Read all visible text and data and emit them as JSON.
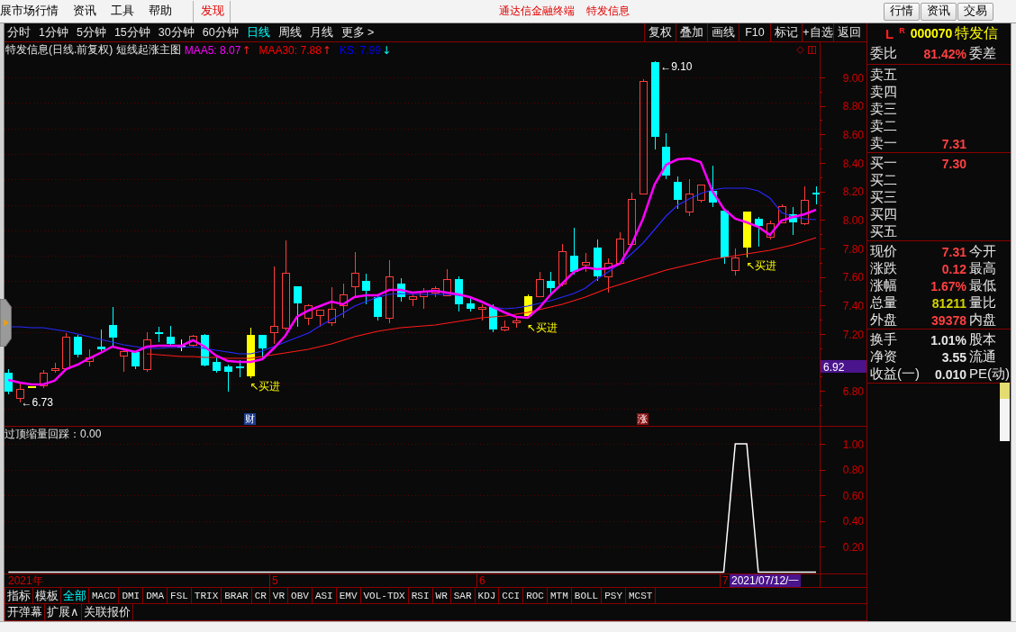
{
  "menu_bar": {
    "items": [
      {
        "label": "展市场行情",
        "highlighted": false
      },
      {
        "label": "资讯",
        "highlighted": false
      },
      {
        "label": "工具",
        "highlighted": false
      },
      {
        "label": "帮助",
        "highlighted": false
      },
      {
        "label": "发现",
        "highlighted": true
      }
    ],
    "title": [
      "通达信金融终端",
      "特发信息"
    ],
    "buttons": [
      "行情",
      "资讯",
      "交易"
    ]
  },
  "period_bar": {
    "periods": [
      {
        "label": "分时",
        "selected": false
      },
      {
        "label": "1分钟",
        "selected": false
      },
      {
        "label": "5分钟",
        "selected": false
      },
      {
        "label": "15分钟",
        "selected": false
      },
      {
        "label": "30分钟",
        "selected": false
      },
      {
        "label": "60分钟",
        "selected": false
      },
      {
        "label": "日线",
        "selected": true
      },
      {
        "label": "周线",
        "selected": false
      },
      {
        "label": "月线",
        "selected": false
      },
      {
        "label": "更多 >",
        "selected": false
      }
    ],
    "tools": [
      "复权",
      "叠加",
      "画线",
      "F10",
      "标记",
      "+自选",
      "返回"
    ]
  },
  "main_chart": {
    "title": "特发信息(日线.前复权) 短线起涨主图",
    "legend": [
      {
        "label": "MAA5: 8.07",
        "color": "#ff00ff",
        "arrow": "↑",
        "rising": true
      },
      {
        "label": "MAA30: 7.88",
        "color": "#ff0000",
        "arrow": "↑",
        "rising": true
      },
      {
        "label": "KS: 7.99",
        "color": "#0000ff",
        "arrow": "↓",
        "rising": false
      }
    ],
    "price_axis": [
      "9.00",
      "8.80",
      "8.60",
      "8.40",
      "8.20",
      "8.00",
      "7.80",
      "7.60",
      "7.40",
      "7.20",
      "6.80"
    ],
    "cursor_price": "6.92",
    "annotations": [
      {
        "kind": "high",
        "text": "←9.10"
      },
      {
        "kind": "low",
        "text": "←6.73"
      },
      {
        "kind": "buy",
        "text": "↖买进"
      },
      {
        "kind": "buy",
        "text": "↖买进"
      },
      {
        "kind": "buy",
        "text": "↖买进"
      }
    ],
    "markers": [
      {
        "kind": "finance",
        "label": "财"
      },
      {
        "kind": "limit_up",
        "label": "涨"
      }
    ]
  },
  "indicator": {
    "reading": "：0.00",
    "chart_data": {
      "type": "line",
      "series": [
        {
          "name": "过顶缩量回踩",
          "color": "#ffffff",
          "values": [
            0,
            0,
            0,
            0,
            0,
            0,
            0,
            0,
            0,
            0,
            0,
            0,
            0,
            0,
            0,
            0,
            0,
            0,
            0,
            0,
            0,
            0,
            0,
            0,
            0,
            0,
            0,
            0,
            0,
            0,
            0,
            0,
            0,
            0,
            0,
            0,
            0,
            0,
            0,
            0,
            0,
            0,
            0,
            0,
            0,
            0,
            0,
            0,
            0,
            0,
            0,
            0,
            0,
            0,
            0,
            0,
            0,
            0,
            0,
            0,
            0,
            0,
            0,
            1,
            1,
            0,
            0,
            0,
            0,
            0,
            0
          ]
        }
      ],
      "ylim": [
        0,
        1.13
      ],
      "yticks": [
        {
          "value": 1,
          "label": "1.00"
        },
        {
          "value": 0.8,
          "label": "0.80"
        },
        {
          "value": 0.6,
          "label": "0.60"
        },
        {
          "value": 0.4,
          "label": "0.40"
        },
        {
          "value": 0.2,
          "label": "0.20"
        }
      ],
      "grid": true
    }
  },
  "time_axis": {
    "labels": [
      {
        "kind": "year",
        "text": "2021年"
      },
      {
        "kind": "month",
        "text": "5"
      },
      {
        "kind": "month",
        "text": "6"
      },
      {
        "kind": "month",
        "text": "7"
      }
    ],
    "cursor_date": "2021/07/12/一"
  },
  "indicator_tabs": [
    {
      "label": "指标",
      "kind": "category",
      "selected": false
    },
    {
      "label": "模板",
      "kind": "category",
      "selected": false
    },
    {
      "label": "全部",
      "kind": "category",
      "selected": true
    },
    {
      "label": "MACD",
      "kind": "indicator",
      "selected": false
    },
    {
      "label": "DMI",
      "kind": "indicator",
      "selected": false
    },
    {
      "label": "DMA",
      "kind": "indicator",
      "selected": false
    },
    {
      "label": "FSL",
      "kind": "indicator",
      "selected": false
    },
    {
      "label": "TRIX",
      "kind": "indicator",
      "selected": false
    },
    {
      "label": "BRAR",
      "kind": "indicator",
      "selected": false
    },
    {
      "label": "CR",
      "kind": "indicator",
      "selected": false
    },
    {
      "label": "VR",
      "kind": "indicator",
      "selected": false
    },
    {
      "label": "OBV",
      "kind": "indicator",
      "selected": false
    },
    {
      "label": "ASI",
      "kind": "indicator",
      "selected": false
    },
    {
      "label": "EMV",
      "kind": "indicator",
      "selected": false
    },
    {
      "label": "VOL-TDX",
      "kind": "indicator",
      "selected": false
    },
    {
      "label": "RSI",
      "kind": "indicator",
      "selected": false
    },
    {
      "label": "WR",
      "kind": "indicator",
      "selected": false
    },
    {
      "label": "SAR",
      "kind": "indicator",
      "selected": false
    },
    {
      "label": "KDJ",
      "kind": "indicator",
      "selected": false
    },
    {
      "label": "CCI",
      "kind": "indicator",
      "selected": false
    },
    {
      "label": "ROC",
      "kind": "indicator",
      "selected": false
    },
    {
      "label": "MTM",
      "kind": "indicator",
      "selected": false
    },
    {
      "label": "BOLL",
      "kind": "indicator",
      "selected": false
    },
    {
      "label": "PSY",
      "kind": "indicator",
      "selected": false
    },
    {
      "label": "MCST",
      "kind": "indicator",
      "selected": false
    }
  ],
  "bottom_buttons": [
    "开弹幕",
    "扩展∧",
    "关联报价"
  ],
  "quote": {
    "market": "L",
    "flag": "R",
    "code": "000070",
    "name": "特发信",
    "ratio": {
      "label": "委比",
      "value": "81.42%",
      "label2": "委差"
    },
    "asks": [
      {
        "label": "卖五"
      },
      {
        "label": "卖四"
      },
      {
        "label": "卖三"
      },
      {
        "label": "卖二"
      },
      {
        "label": "卖一",
        "price": "7.31"
      }
    ],
    "bids": [
      {
        "label": "买一",
        "price": "7.30"
      },
      {
        "label": "买二"
      },
      {
        "label": "买三"
      },
      {
        "label": "买四"
      },
      {
        "label": "买五"
      }
    ],
    "stats": [
      {
        "label": "现价",
        "value": "7.31",
        "color": "#ff4040",
        "label2": "今开"
      },
      {
        "label": "涨跌",
        "value": "0.12",
        "color": "#ff4040",
        "label2": "最高"
      },
      {
        "label": "涨幅",
        "value": "1.67%",
        "color": "#ff4040",
        "label2": "最低"
      },
      {
        "label": "总量",
        "value": "81211",
        "color": "#d2d200",
        "label2": "量比"
      },
      {
        "label": "外盘",
        "value": "39378",
        "color": "#ff4040",
        "label2": "内盘"
      }
    ],
    "fundamentals": [
      {
        "label": "换手",
        "value": "1.01%",
        "label2": "股本"
      },
      {
        "label": "净资",
        "value": "3.55",
        "label2": "流通"
      },
      {
        "label": "收益(一)",
        "value": "0.010",
        "label2": "PE(动)"
      }
    ]
  }
}
